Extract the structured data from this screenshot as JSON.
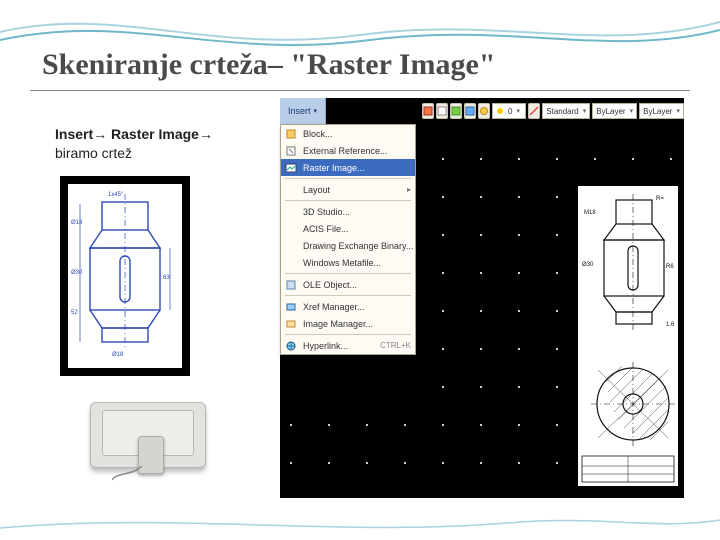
{
  "title": "Skeniranje crteža– \"Raster Image\"",
  "instruction": {
    "line1_bold": "Insert",
    "arrow": "→",
    "line1_bold2": "Raster Image",
    "line2": "biramo crtež"
  },
  "colors": {
    "accentWave": "#6fb7c9",
    "drawingBlue": "#2d49b8",
    "menuHighlight": "#3c6bbf"
  },
  "toolbar": {
    "menuButton": "Insert",
    "selectors": [
      {
        "label": "Standard"
      },
      {
        "label": "ByLayer"
      },
      {
        "label": "ByLayer"
      }
    ]
  },
  "menu": {
    "items": [
      {
        "icon": "block-icon",
        "label": "Block..."
      },
      {
        "icon": "extref-icon",
        "label": "External Reference..."
      },
      {
        "icon": "raster-icon",
        "label": "Raster Image...",
        "selected": true
      },
      {
        "sep": true
      },
      {
        "icon": "",
        "label": "Layout",
        "submenu": true
      },
      {
        "sep": true
      },
      {
        "icon": "",
        "label": "3D Studio..."
      },
      {
        "icon": "",
        "label": "ACIS File..."
      },
      {
        "icon": "",
        "label": "Drawing Exchange Binary..."
      },
      {
        "icon": "",
        "label": "Windows Metafile..."
      },
      {
        "sep": true
      },
      {
        "icon": "ole-icon",
        "label": "OLE Object..."
      },
      {
        "sep": true
      },
      {
        "icon": "xrefmgr-icon",
        "label": "Xref Manager..."
      },
      {
        "icon": "imgmgr-icon",
        "label": "Image Manager..."
      },
      {
        "sep": true
      },
      {
        "icon": "globe-icon",
        "label": "Hyperlink...",
        "shortcut": "CTRL+K"
      }
    ]
  },
  "leftDrawing": {
    "topLabel": "1x45°",
    "dims": [
      "Ø18",
      "Ø30",
      "63",
      "52",
      "Ø18"
    ]
  },
  "rightDrawing": {
    "labels": [
      "R=",
      "M18",
      "Ø30",
      "R6",
      "1.6"
    ]
  }
}
